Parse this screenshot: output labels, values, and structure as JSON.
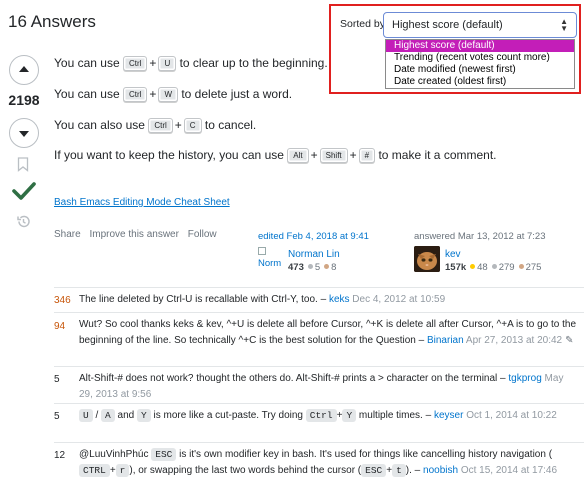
{
  "title": "16 Answers",
  "sort": {
    "label": "Sorted by:",
    "selected": "Highest score (default)",
    "options": [
      "Highest score (default)",
      "Trending (recent votes count more)",
      "Date modified (newest first)",
      "Date created (oldest first)"
    ]
  },
  "votes": {
    "count": "2198"
  },
  "answer": {
    "l1": {
      "pre": "You can use",
      "k1": "Ctrl",
      "plus": "+",
      "k2": "U",
      "post": "to clear up to the beginning."
    },
    "l2": {
      "pre": "You can use",
      "k1": "Ctrl",
      "plus": "+",
      "k2": "W",
      "post": "to delete just a word."
    },
    "l3": {
      "pre": "You can also use",
      "k1": "Ctrl",
      "plus": "+",
      "k2": "C",
      "post": "to cancel."
    },
    "l4": {
      "pre": "If you want to keep the history, you can use",
      "k1": "Alt",
      "plus1": "+",
      "k2": "Shift",
      "plus2": "+",
      "k3": "#",
      "post": "to make it a comment."
    },
    "cheat_link": "Bash Emacs Editing Mode Cheat Sheet"
  },
  "post_menu": {
    "share": "Share",
    "improve": "Improve this answer",
    "follow": "Follow"
  },
  "editor": {
    "edited": "edited Feb 4, 2018 at 9:41",
    "avatar_alt": "Norm",
    "name": "Norman Lin",
    "rep": "473",
    "silver": "5",
    "bronze": "8"
  },
  "author": {
    "answered": "answered Mar 13, 2012 at 7:23",
    "name": "kev",
    "rep": "157k",
    "gold": "48",
    "silver": "279",
    "bronze": "275"
  },
  "colors": {
    "accent_border": "#e0201f",
    "selected_option": "#c31eb8",
    "link": "#0074cc",
    "accepted": "#2f6f44",
    "score_hot": "#c75509"
  },
  "comments": [
    {
      "score": "346",
      "text": "The line deleted by Ctrl-U is recallable with Ctrl-Y, too. –",
      "user": "keks",
      "date": "Dec 4, 2012 at 10:59"
    },
    {
      "score": "94",
      "text": "Wut? So cool thanks keks & kev, ^+U is delete all before Cursor, ^+K is delete all after Cursor, ^+A is to go to the beginning of the line. So technically ^+C is the best solution for the Question –",
      "user": "Binarian",
      "date": "Apr 27, 2013 at 20:42"
    },
    {
      "score": "5",
      "text": "Alt-Shift-# does not work? thought the others do. Alt-Shift-# prints a > character on the terminal –",
      "user": "tgkprog",
      "date": "May 29, 2013 at 9:56"
    },
    {
      "score": "5",
      "k1": "U",
      "slash": "/",
      "k2": "A",
      "and": "and",
      "k3": "Y",
      "mid": "is more like a cut-paste. Try doing",
      "k4": "Ctrl",
      "plus": "+",
      "k5": "Y",
      "end": "multiple times. –",
      "user": "keyser",
      "date": "Oct 1, 2014 at 10:22"
    },
    {
      "score": "12",
      "pre": "@LuuVinhPhúc",
      "k1": "ESC",
      "mid1": "is it's own modifier key in bash. It's used for things like cancelling history navigation (",
      "k2": "CTRL",
      "plus": "+",
      "k3": "r",
      "mid2": "), or swapping the last two words behind the cursor (",
      "k4": "ESC",
      "plus2": "+",
      "k5": "t",
      "end": "). –",
      "user": "noobish",
      "date": "Oct 15, 2014 at 17:46"
    }
  ]
}
